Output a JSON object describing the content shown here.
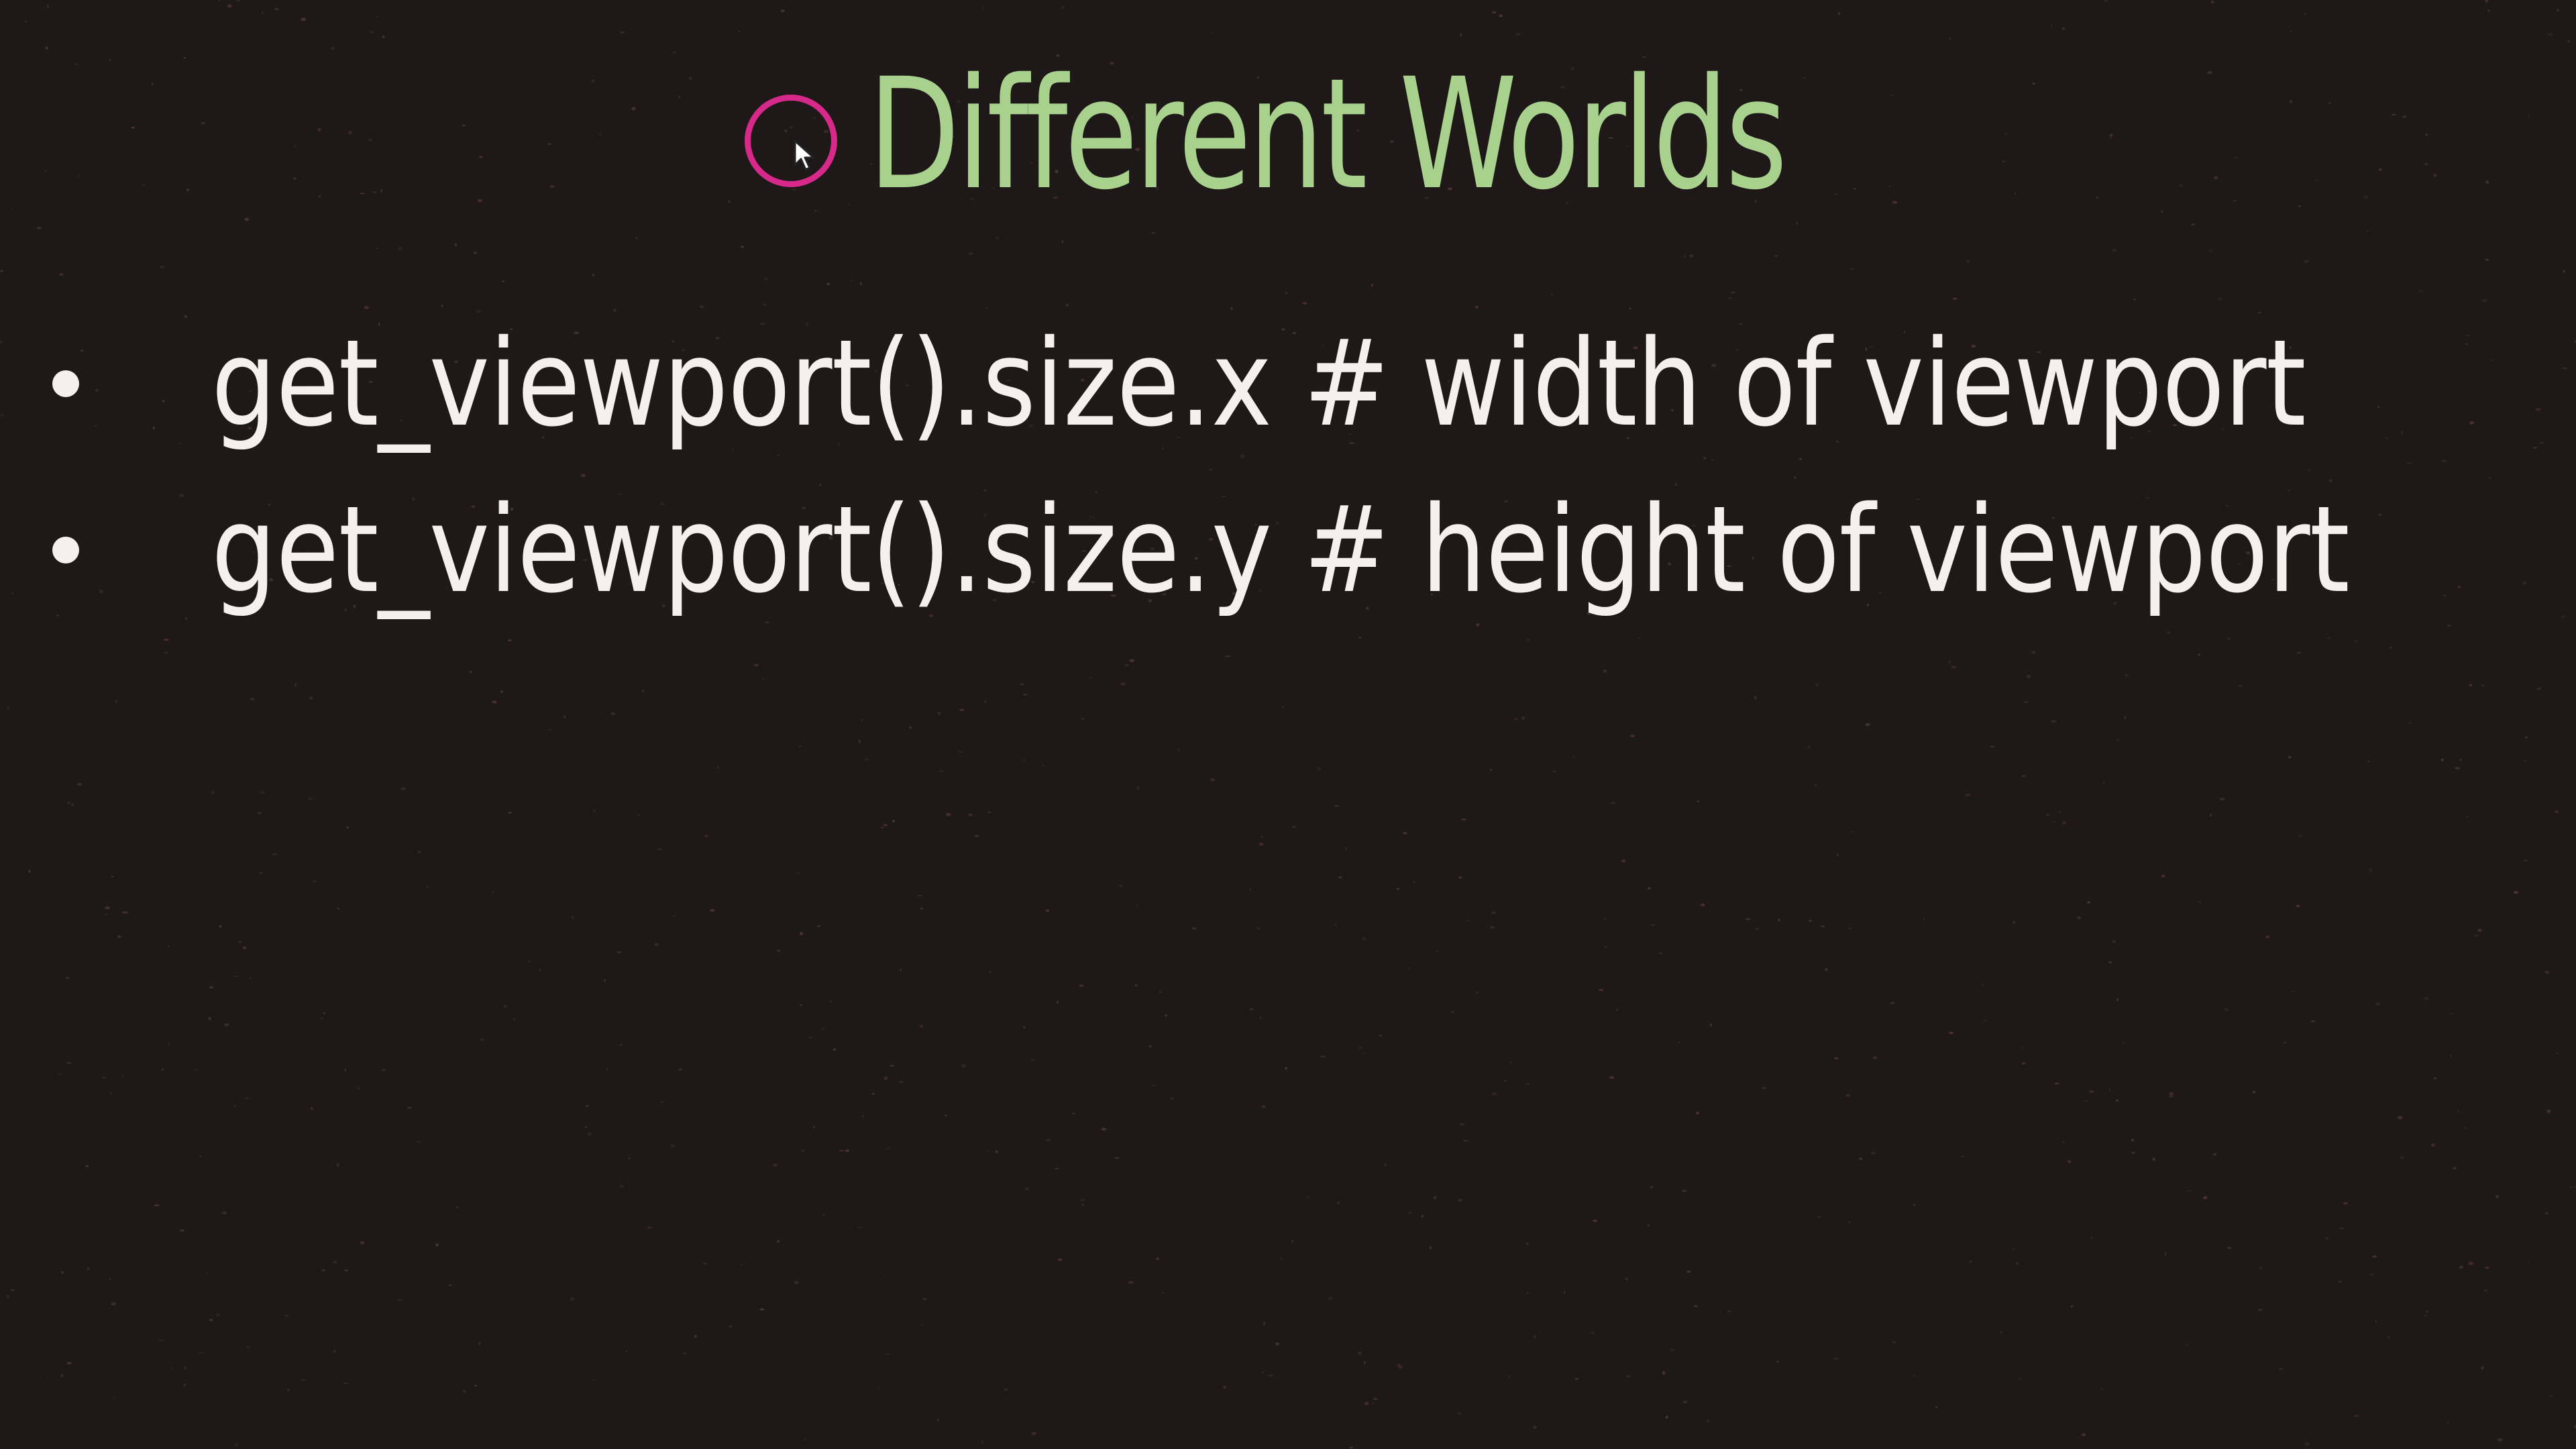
{
  "slide": {
    "title": "Different Worlds",
    "bullets": [
      {
        "text": "get_viewport().size.x # width of viewport"
      },
      {
        "text": "get_viewport().size.y # height of viewport"
      }
    ]
  },
  "cursor": {
    "icon": "mouse-pointer-icon",
    "highlight_color": "#d6298a"
  },
  "colors": {
    "background": "#1f1818",
    "title": "#a9d18e",
    "body_text": "#f5f0ee",
    "speckle": "#5a3b3b"
  }
}
